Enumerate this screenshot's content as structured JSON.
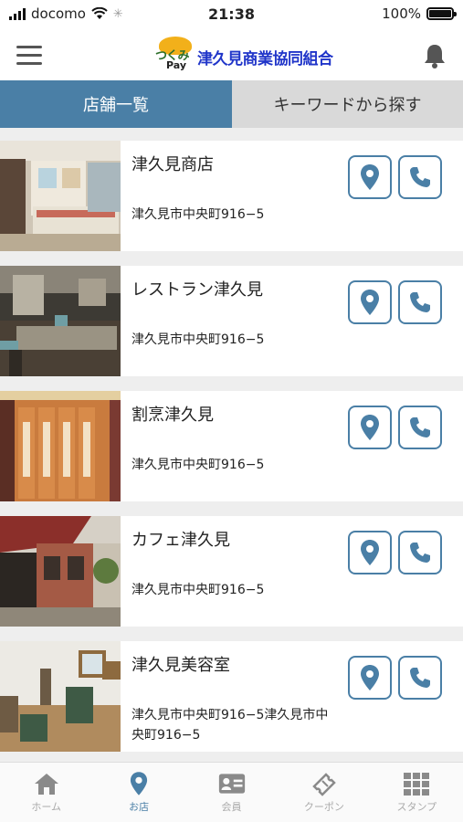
{
  "status_bar": {
    "carrier": "docomo",
    "time": "21:38",
    "battery": "100%",
    "battery_level": 1.0
  },
  "header": {
    "logo_kana": "つくみ",
    "logo_pay": "Pay",
    "logo_name": "津久見商業協同組合",
    "menu_icon": "hamburger-icon",
    "bell_icon": "bell-icon"
  },
  "tabs": [
    {
      "label": "店舗一覧",
      "active": true
    },
    {
      "label": "キーワードから探す",
      "active": false
    }
  ],
  "stores": [
    {
      "name": "津久見商店",
      "address": "津久見市中央町916−5",
      "image": "shop-interior"
    },
    {
      "name": "レストラン津久見",
      "address": "津久見市中央町916−5",
      "image": "restaurant-interior"
    },
    {
      "name": "割烹津久見",
      "address": "津久見市中央町916−5",
      "image": "japanese-doors"
    },
    {
      "name": "カフェ津久見",
      "address": "津久見市中央町916−5",
      "image": "cafe-exterior"
    },
    {
      "name": "津久見美容室",
      "address": "津久見市中央町916−5津久見市中央町916−5",
      "image": "salon-interior"
    }
  ],
  "bottom_nav": [
    {
      "label": "ホーム",
      "icon": "home-icon",
      "active": false
    },
    {
      "label": "お店",
      "icon": "map-pin-icon",
      "active": true
    },
    {
      "label": "会員",
      "icon": "member-card-icon",
      "active": false
    },
    {
      "label": "クーポン",
      "icon": "ticket-icon",
      "active": false
    },
    {
      "label": "スタンプ",
      "icon": "grid-icon",
      "active": false
    }
  ],
  "colors": {
    "accent": "#4a7fa6",
    "logo_blue": "#2035c9",
    "inactive_tab": "#d9d9d9",
    "list_background": "#eeeeee"
  }
}
